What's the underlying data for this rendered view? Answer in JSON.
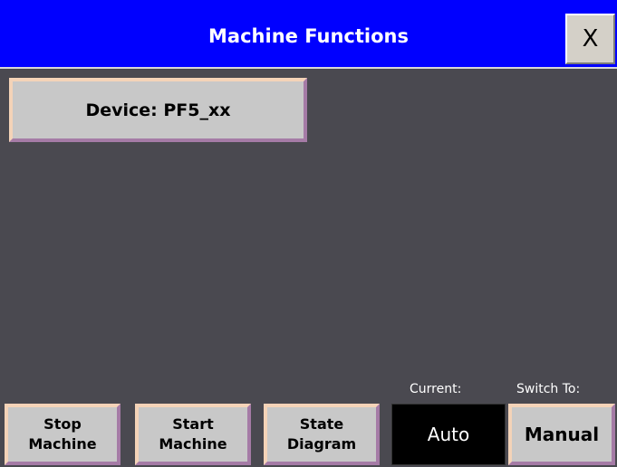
{
  "window": {
    "title": "Machine Functions",
    "close_label": "X"
  },
  "main": {
    "device_button_label": "Device: PF5_xx"
  },
  "bottom_bar": {
    "stop_label": "Stop\nMachine",
    "start_label": "Start\nMachine",
    "state_label": "State\nDiagram",
    "current_heading": "Current:",
    "current_mode": "Auto",
    "switch_heading": "Switch To:",
    "switch_label": "Manual"
  },
  "colors": {
    "title_bar": "#0000ff",
    "background": "#4a4950",
    "button_face": "#c8c8c8",
    "button_highlight": "#f4d3b8",
    "button_shadow": "#a57ba6",
    "current_mode_bg": "#000000"
  }
}
